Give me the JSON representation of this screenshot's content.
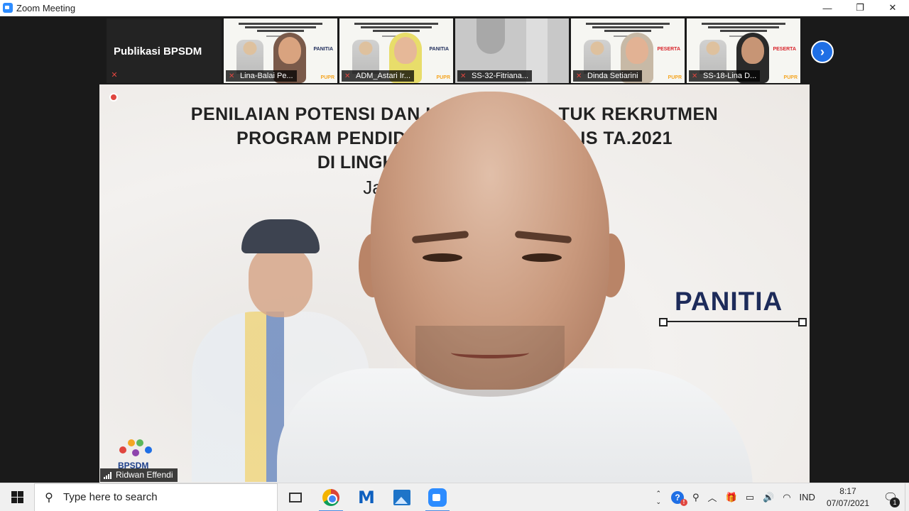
{
  "window": {
    "title": "Zoom Meeting",
    "minimize_glyph": "—",
    "maximize_glyph": "❐",
    "close_glyph": "✕"
  },
  "gallery": {
    "name_tile": "Publikasi BPSDM",
    "participants": [
      {
        "name": "Lina-Balai Pe...",
        "role": "PANITIA",
        "muted": true
      },
      {
        "name": "ADM_Astari Ir...",
        "role": "PANITIA",
        "muted": true
      },
      {
        "name": "SS-32-Fitriana...",
        "role": "",
        "muted": true
      },
      {
        "name": "Dinda Setiarini",
        "role": "PESERTA",
        "muted": true
      },
      {
        "name": "SS-18-Lina D...",
        "role": "PESERTA",
        "muted": true
      }
    ],
    "next_glyph": "›",
    "mini_logo": "PUPR"
  },
  "main_video": {
    "slide_line1": "PENILAIAN POTENSI DAN KO                    TUK REKRUTMEN",
    "slide_line2": "PROGRAM PENDIDIKAN                    ALIS TA.2021",
    "slide_line3": "DI LINGKUN                                R",
    "slide_line4": "Ja",
    "panitia": "PANITIA",
    "logo_text": "BPSDM",
    "speaker_name": "Ridwan Effendi"
  },
  "taskbar": {
    "search_placeholder": "Type here to search",
    "search_glyph": "⚲",
    "tray_language": "IND",
    "time": "8:17",
    "date": "07/07/2021",
    "notification_count": "1",
    "up_glyph": "⌃",
    "down_glyph": "⌄",
    "tray_chevron": "︿",
    "help_glyph": "?",
    "people_glyph": "⚲",
    "gift_glyph": "🎁",
    "battery_glyph": "▭",
    "volume_glyph": "🔊",
    "wifi_glyph": "◠",
    "notif_glyph": "🗨"
  }
}
